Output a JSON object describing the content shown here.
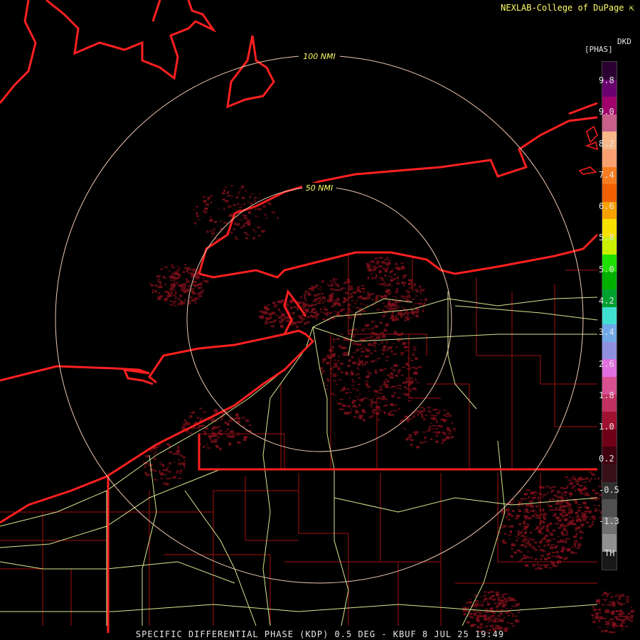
{
  "credit": "NEXLAB-College of DuPage",
  "footer": "SPECIFIC DIFFERENTIAL PHASE (KDP) 0.5 DEG - KBUF 8 JUL 25 19:49",
  "rings": {
    "inner_label": "50 NMI",
    "outer_label": "100 NMI"
  },
  "legend": {
    "product": "DKD",
    "units": "[PHAS]",
    "labels": [
      "9.8",
      "9.0",
      "8.2",
      "7.4",
      "6.6",
      "5.8",
      "5.0",
      "4.2",
      "3.4",
      "2.6",
      "1.8",
      "1.0",
      "0.2",
      "-0.5",
      "-1.3",
      "TH"
    ],
    "colors": [
      "#2a0030",
      "#6a0070",
      "#a0006a",
      "#c8608a",
      "#f8b888",
      "#f8a070",
      "#f87c20",
      "#f06000",
      "#f8a000",
      "#f8e000",
      "#c8f000",
      "#20e000",
      "#00b000",
      "#00a030",
      "#40e0d0",
      "#70a8e8",
      "#9090e0",
      "#e070e0",
      "#d85090",
      "#c03060",
      "#a01030",
      "#700018",
      "#400010",
      "#381018",
      "#303030",
      "#505050",
      "#707070",
      "#909090",
      "#181818"
    ]
  },
  "colors": {
    "background": "#000000",
    "state_border": "#ff2020",
    "county_border": "#a01010",
    "highway": "#d8e890",
    "ring": "#f0c8b0",
    "echo": "#7a0f1a"
  }
}
